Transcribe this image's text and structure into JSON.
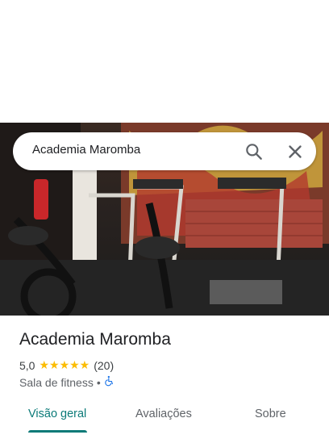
{
  "search": {
    "query": "Academia Maromba"
  },
  "place": {
    "name": "Academia Maromba",
    "rating": "5,0",
    "stars": "★★★★★",
    "review_count": "(20)",
    "category": "Sala de fitness",
    "separator": "•"
  },
  "tabs": [
    {
      "label": "Visão geral",
      "active": true
    },
    {
      "label": "Avaliações",
      "active": false
    },
    {
      "label": "Sobre",
      "active": false
    }
  ],
  "colors": {
    "accent": "#0b7a78",
    "star": "#fbbc04",
    "wheelchair": "#1a73e8"
  },
  "icons": {
    "search": "search-icon",
    "close": "close-icon",
    "accessibility": "wheelchair-icon"
  }
}
